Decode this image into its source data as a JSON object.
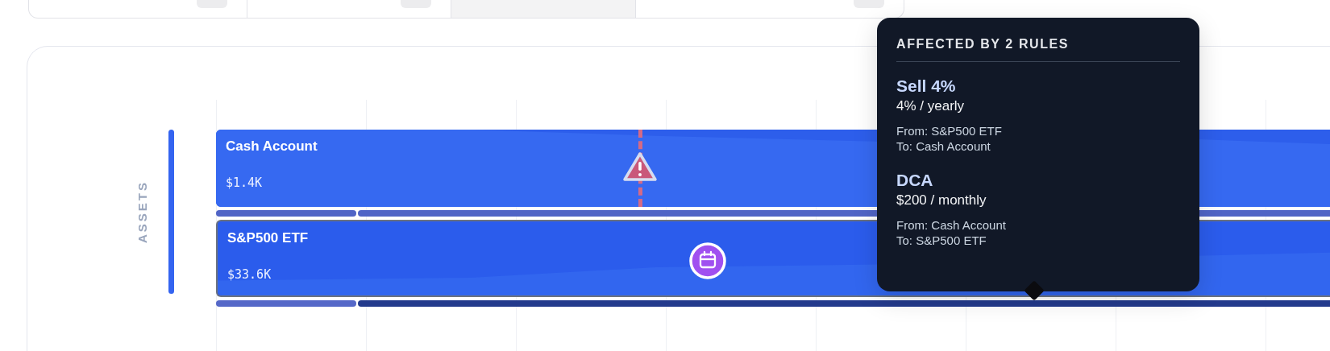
{
  "tabs": [
    {
      "selected": false
    },
    {
      "selected": false
    },
    {
      "selected": true
    },
    {
      "selected": false
    }
  ],
  "timeline": {
    "group_label": "ASSETS",
    "rows": [
      {
        "name": "Cash Account",
        "value": "$1.4K",
        "selected": false,
        "markers": [
          {
            "kind": "warning"
          }
        ],
        "segments": [
          {
            "color": "#5064c6"
          },
          {
            "color": "#5064c6"
          }
        ]
      },
      {
        "name": "S&P500 ETF",
        "value": "$33.6K",
        "selected": true,
        "markers": [
          {
            "kind": "calendar"
          }
        ],
        "segments": [
          {
            "color": "#5568c8"
          },
          {
            "color": "#233a8c"
          }
        ]
      }
    ]
  },
  "tooltip": {
    "title": "AFFECTED BY 2 RULES",
    "rules": [
      {
        "name": "Sell 4%",
        "amount": "4% / yearly",
        "from": "From: S&P500 ETF",
        "to": "To: Cash Account"
      },
      {
        "name": "DCA",
        "amount": "$200 / monthly",
        "from": "From: Cash Account",
        "to": "To: S&P500 ETF"
      }
    ]
  }
}
